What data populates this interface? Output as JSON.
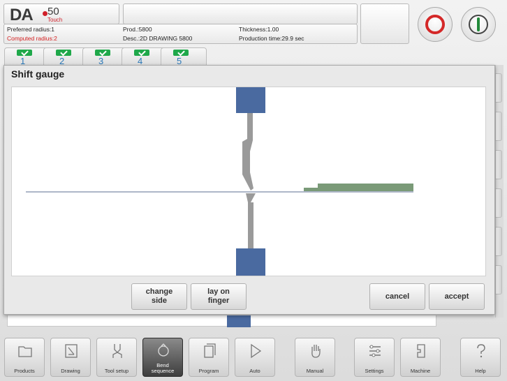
{
  "header": {
    "logo_text": "DA",
    "logo_model": "50",
    "logo_sub": "Touch",
    "preferred_radius": "Preferred radius:1",
    "computed_radius": "Computed radius:2",
    "prod": "Prod.:5800",
    "desc": "Desc.:2D DRAWING 5800",
    "thickness": "Thickness:1.00",
    "production_time": "Production time:29.9 sec"
  },
  "steps": [
    {
      "label": "1",
      "active": true
    },
    {
      "label": "2",
      "active": false
    },
    {
      "label": "3",
      "active": false
    },
    {
      "label": "4",
      "active": false
    },
    {
      "label": "5",
      "active": false
    }
  ],
  "dialog": {
    "title": "Shift gauge",
    "change_side": "change\nside",
    "lay_on_finger": "lay on\nfinger",
    "cancel": "cancel",
    "accept": "accept"
  },
  "colors": {
    "die_block": "#4a6aa0",
    "tool": "#9a9a9a",
    "sheet": "#7a9a78",
    "stop_red": "#d42828",
    "start_green": "#228a3a",
    "computed_radius_red": "#d42020"
  },
  "nav": [
    {
      "label": "Products",
      "icon": "folder-icon"
    },
    {
      "label": "Drawing",
      "icon": "drawing-icon"
    },
    {
      "label": "Tool setup",
      "icon": "tool-setup-icon"
    },
    {
      "label": "Bend\nsequence",
      "icon": "bend-sequence-icon",
      "active": true
    },
    {
      "label": "Program",
      "icon": "program-icon"
    },
    {
      "label": "Auto",
      "icon": "play-icon"
    },
    {
      "label": "Manual",
      "icon": "hand-icon"
    },
    {
      "label": "Settings",
      "icon": "settings-icon"
    },
    {
      "label": "Machine",
      "icon": "machine-icon"
    },
    {
      "label": "Help",
      "icon": "help-icon"
    }
  ]
}
